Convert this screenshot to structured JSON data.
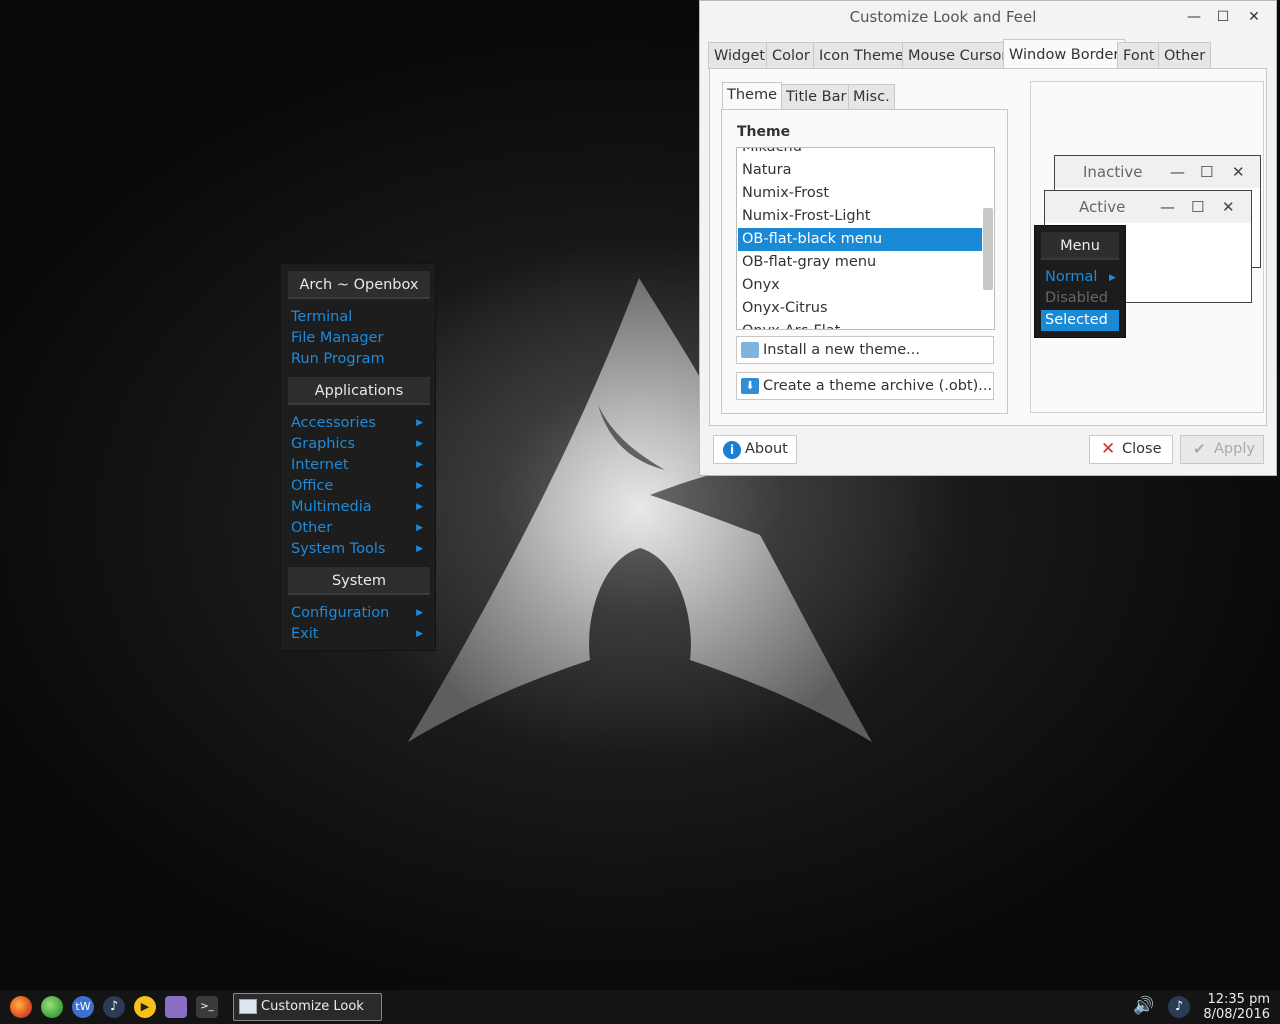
{
  "root_menu": {
    "title": "Arch ~ Openbox",
    "top_items": [
      "Terminal",
      "File Manager",
      "Run Program"
    ],
    "applications_header": "Applications",
    "applications": [
      "Accessories",
      "Graphics",
      "Internet",
      "Office",
      "Multimedia",
      "Other",
      "System Tools"
    ],
    "system_header": "System",
    "system": [
      "Configuration",
      "Exit"
    ]
  },
  "window": {
    "title": "Customize Look and Feel",
    "tabs": [
      "Widget",
      "Color",
      "Icon Theme",
      "Mouse Cursor",
      "Window Border",
      "Font",
      "Other"
    ],
    "active_tab": "Window Border",
    "subtabs": [
      "Theme",
      "Title Bar",
      "Misc."
    ],
    "theme_label": "Theme",
    "themes": [
      "Mikachu",
      "Natura",
      "Numix-Frost",
      "Numix-Frost-Light",
      "OB-flat-black menu",
      "OB-flat-gray menu",
      "Onyx",
      "Onyx-Citrus",
      "Onyx-Arc-Flat"
    ],
    "selected_theme": "OB-flat-black menu",
    "install_button": "Install a new theme...",
    "archive_button": "Create a theme archive (.obt)...",
    "preview": {
      "inactive_title": "Inactive",
      "active_title": "Active",
      "menu_title": "Menu",
      "menu_normal": "Normal",
      "menu_disabled": "Disabled",
      "menu_selected": "Selected"
    },
    "about_button": "About",
    "close_button": "Close",
    "apply_button": "Apply"
  },
  "taskbar": {
    "task_label": "Customize Look an...",
    "time": "12:35 pm",
    "date": "8/08/2016",
    "launchers": [
      "firefox-icon",
      "globe-icon",
      "tw-icon",
      "music-icon",
      "media-player-icon",
      "folder-icon",
      "terminal-icon"
    ],
    "tw_text": "tW"
  },
  "colors": {
    "accent": "#1a8ad6",
    "menu_text": "#1e8ad8",
    "menu_bg": "#1d1d1d"
  }
}
